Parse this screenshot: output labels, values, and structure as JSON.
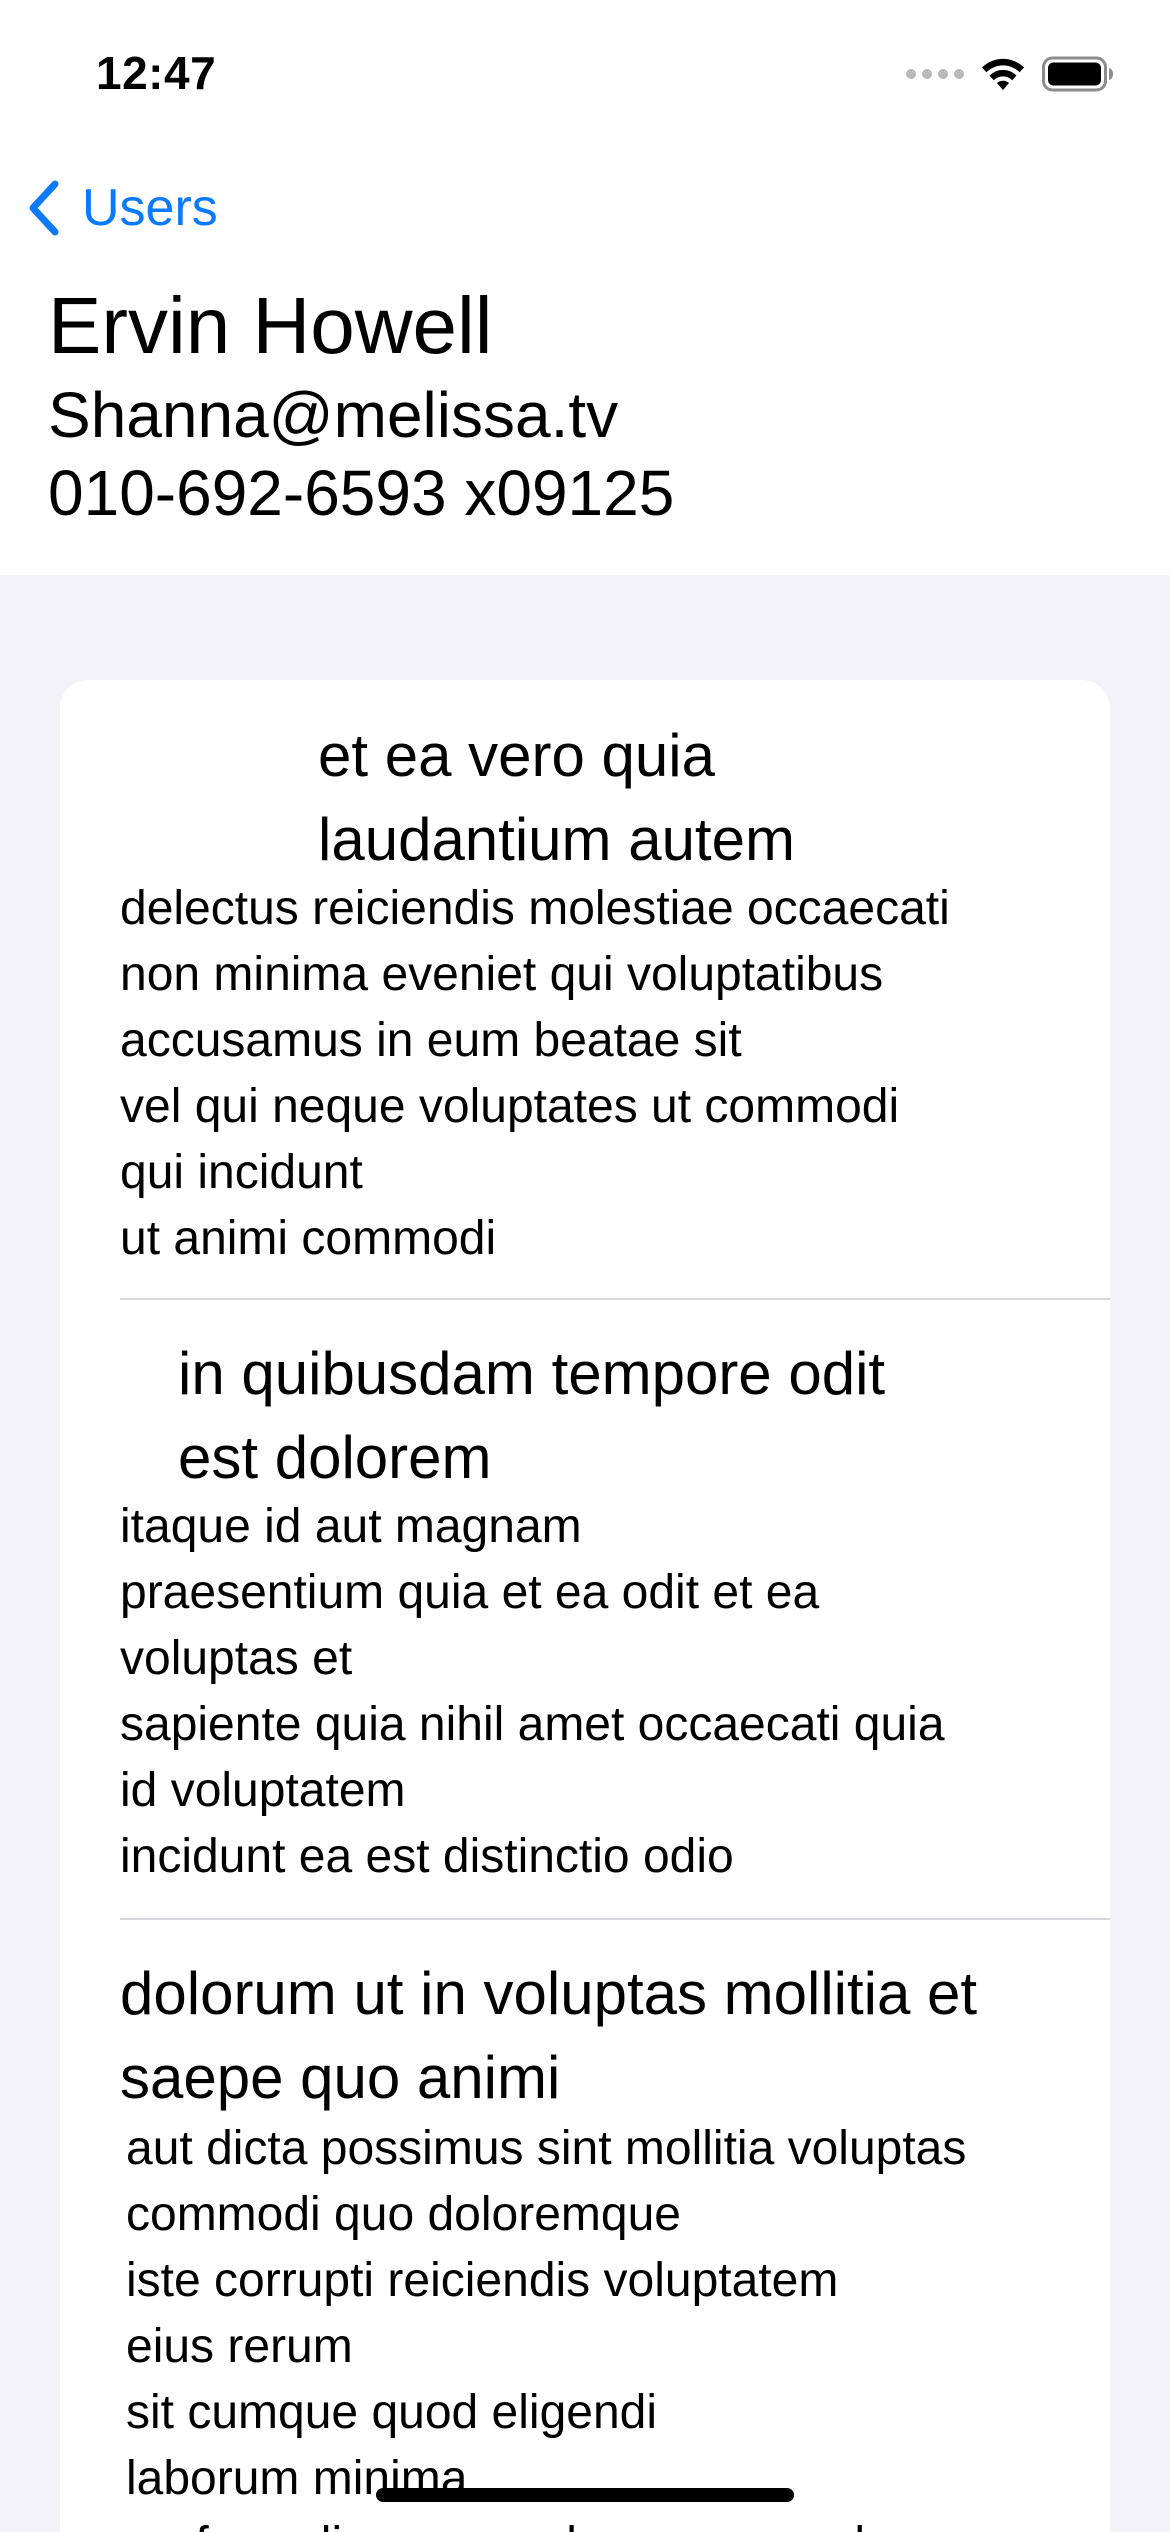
{
  "status_bar": {
    "time": "12:47",
    "icons": [
      "signal-dots-icon",
      "wifi-icon",
      "battery-icon"
    ]
  },
  "nav": {
    "back_label": "Users",
    "back_icon": "chevron-left-icon",
    "accent_color": "#0A7AFF"
  },
  "user": {
    "name": "Ervin Howell",
    "email": "Shanna@melissa.tv",
    "phone": "010-692-6593 x09125"
  },
  "posts": [
    {
      "title": "et ea vero quia\nlaudantium autem",
      "body": "delectus reiciendis molestiae occaecati\nnon minima eveniet qui voluptatibus\naccusamus in eum beatae sit\nvel qui neque voluptates ut commodi\nqui incidunt\nut animi commodi"
    },
    {
      "title": "in quibusdam tempore odit\nest dolorem",
      "body": "itaque id aut magnam\npraesentium quia et ea odit et ea\nvoluptas et\nsapiente quia nihil amet occaecati quia\nid voluptatem\nincidunt ea est distinctio odio"
    },
    {
      "title": "dolorum ut in voluptas mollitia et\nsaepe quo animi",
      "body": "aut dicta possimus sint mollitia voluptas\ncommodi quo doloremque\niste corrupti reiciendis voluptatem\neius rerum\nsit cumque quod eligendi\nlaborum minima\nperferendis recusandae assumenda\nconsectetur porro architecto ipsum ipsam"
    }
  ]
}
